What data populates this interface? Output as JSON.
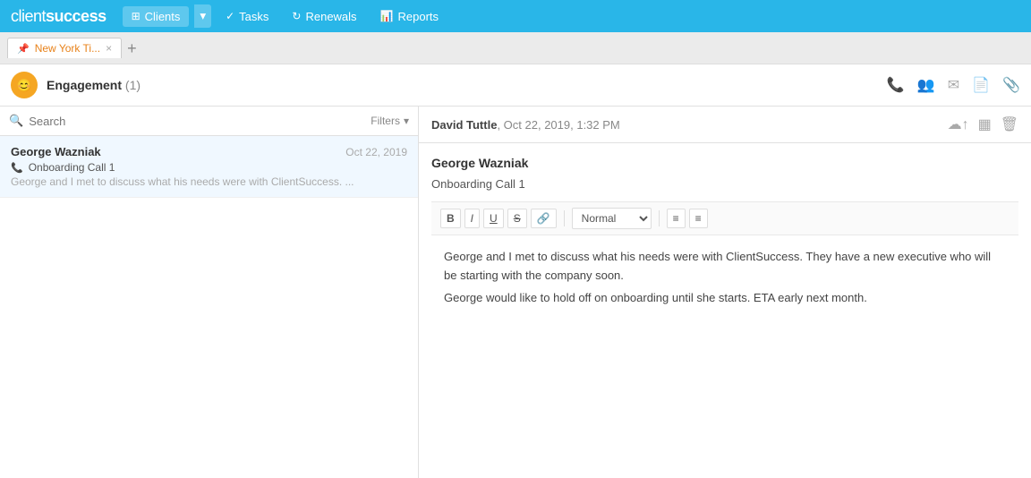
{
  "logo": {
    "client": "client",
    "success": "success"
  },
  "nav": {
    "clients_label": "Clients",
    "tasks_label": "Tasks",
    "renewals_label": "Renewals",
    "reports_label": "Reports"
  },
  "tab": {
    "label": "New York Ti...",
    "pin_icon": "📌",
    "close_icon": "×",
    "add_icon": "+"
  },
  "engagement": {
    "avatar_icon": "😊",
    "title": "Engagement",
    "count": "(1)",
    "actions": {
      "phone": "📞",
      "contacts": "👥",
      "email": "✉",
      "document": "📄",
      "attachment": "📎"
    }
  },
  "search": {
    "placeholder": "Search",
    "filters_label": "Filters"
  },
  "contact": {
    "name": "George Wazniak",
    "date": "Oct 22, 2019",
    "subtitle": "Onboarding Call 1",
    "preview": "George and I met to discuss what his needs were with ClientSuccess. ..."
  },
  "note": {
    "author": "David Tuttle",
    "datetime": "Oct 22, 2019, 1:32 PM",
    "name": "George Wazniak",
    "call_title": "Onboarding Call 1",
    "body_line1": "George and I met to discuss what his needs were with ClientSuccess. They have a new executive who will be starting with the company soon.",
    "body_line2": "George would like to hold off on onboarding until she starts. ETA early next month.",
    "header_icons": {
      "upload": "☁",
      "grid": "▦",
      "trash": "🗑"
    }
  },
  "toolbar": {
    "bold": "B",
    "italic": "I",
    "underline": "U",
    "strike": "S",
    "link": "🔗",
    "format": "Normal",
    "list_ordered": "≡",
    "list_unordered": "≡"
  }
}
